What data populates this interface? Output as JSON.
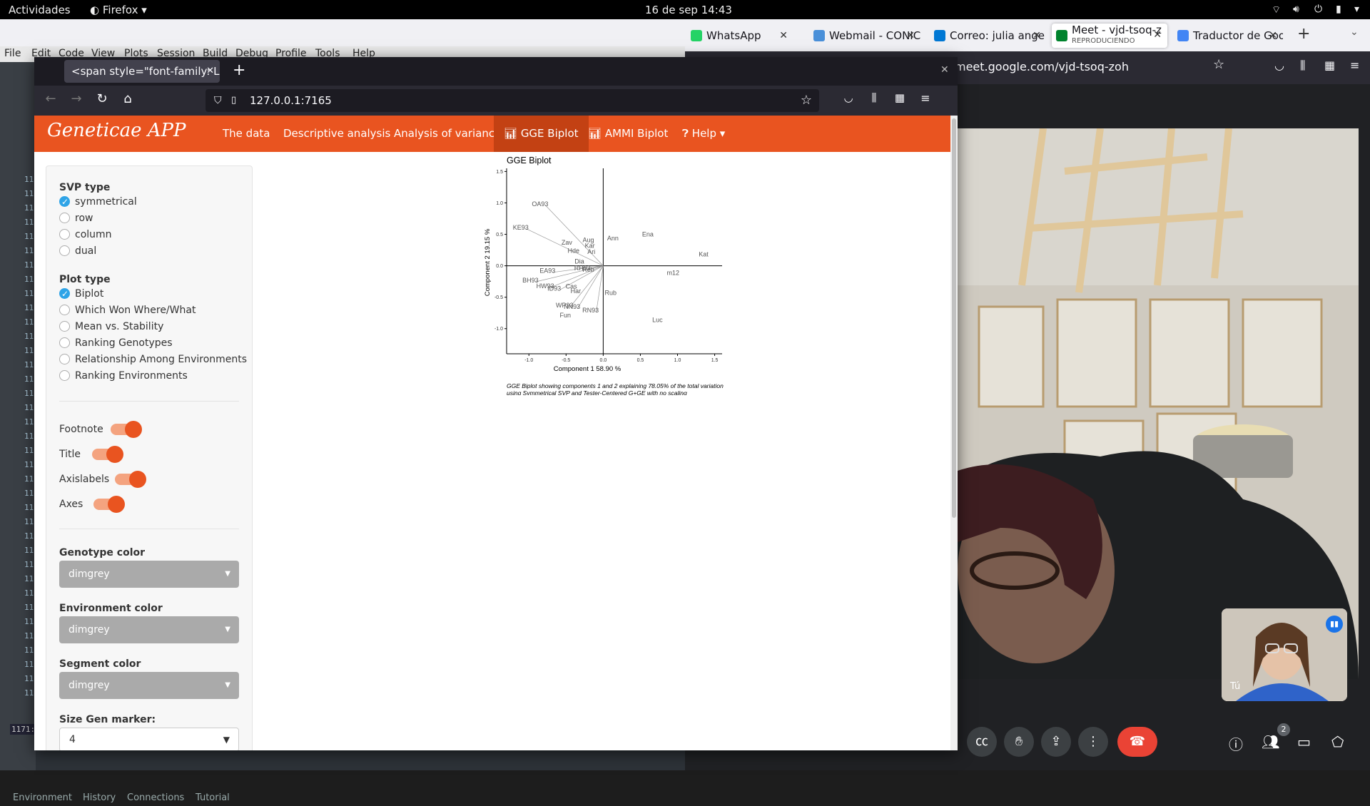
{
  "topbar": {
    "activities": "Actividades",
    "app": "Firefox",
    "datetime": "16 de sep  14:43"
  },
  "bg_browser": {
    "tabs": [
      {
        "label": "WhatsApp",
        "icon_color": "#25d366"
      },
      {
        "label": "Webmail - CONIC",
        "icon_color": "#4a90d9"
      },
      {
        "label": "Correo: julia ange",
        "icon_color": "#0078d4"
      },
      {
        "label": "Meet - vjd-tsoq-z",
        "sublabel": "REPRODUCIENDO",
        "icon_color": "#00832d"
      },
      {
        "label": "Traductor de Goo",
        "icon_color": "#4285f4"
      }
    ],
    "url": "meet.google.com/vjd-tsoq-zoh",
    "self_view_label": "Tú",
    "participants_count": "2"
  },
  "rstudio": {
    "menu": [
      "File",
      "Edit",
      "Code",
      "View",
      "Plots",
      "Session",
      "Build",
      "Debug",
      "Profile",
      "Tools",
      "Help"
    ],
    "line_prefix": "11",
    "line_count_label": "1171:",
    "bottom_tabs": [
      "Environment",
      "History",
      "Connections",
      "Tutorial"
    ]
  },
  "fg_browser": {
    "tab_title": "<span style=\"font-family: Lot",
    "url": "127.0.0.1:7165"
  },
  "app": {
    "brand": "Geneticae APP",
    "nav": [
      {
        "label": "The data"
      },
      {
        "label": "Descriptive analysis"
      },
      {
        "label": "Analysis of variance"
      },
      {
        "label": "GGE Biplot",
        "icon": "bar-chart-icon",
        "active": true
      },
      {
        "label": "AMMI Biplot",
        "icon": "bar-chart-icon"
      },
      {
        "label": "Help",
        "icon": "question-circle-icon"
      }
    ]
  },
  "sidebar": {
    "svp_label": "SVP type",
    "svp_options": [
      {
        "label": "symmetrical",
        "selected": true
      },
      {
        "label": "row",
        "selected": false
      },
      {
        "label": "column",
        "selected": false
      },
      {
        "label": "dual",
        "selected": false
      }
    ],
    "plot_label": "Plot type",
    "plot_options": [
      {
        "label": "Biplot",
        "selected": true
      },
      {
        "label": "Which Won Where/What",
        "selected": false
      },
      {
        "label": "Mean vs. Stability",
        "selected": false
      },
      {
        "label": "Ranking Genotypes",
        "selected": false
      },
      {
        "label": "Relationship Among Environments",
        "selected": false
      },
      {
        "label": "Ranking Environments",
        "selected": false
      }
    ],
    "switches": [
      {
        "label": "Footnote",
        "on": true
      },
      {
        "label": "Title",
        "on": true
      },
      {
        "label": "Axislabels",
        "on": true
      },
      {
        "label": "Axes",
        "on": true
      }
    ],
    "genotype_color_label": "Genotype color",
    "genotype_color": "dimgrey",
    "environment_color_label": "Environment color",
    "environment_color": "dimgrey",
    "segment_color_label": "Segment color",
    "segment_color": "dimgrey",
    "size_gen_label": "Size Gen marker:",
    "size_gen": "4"
  },
  "chart_data": {
    "type": "scatter",
    "title": "GGE Biplot",
    "xlabel": "Component 1 58.90 %",
    "ylabel": "Component 2 19.15 %",
    "xlim": [
      -1.3,
      1.6
    ],
    "ylim": [
      -1.4,
      1.55
    ],
    "xticks": [
      "-1.0",
      "-0.5",
      "0.0",
      "0.5",
      "1.0",
      "1.5"
    ],
    "yticks": [
      "1.5",
      "1.0",
      "0.5",
      "0.0",
      "-0.5",
      "-1.0"
    ],
    "footnote": [
      "GGE Biplot showing components 1 and 2 explaining 78.05% of the total variation",
      "using Symmetrical SVP and Tester-Centered G+GE with no scaling"
    ],
    "genotypes": [
      {
        "label": "Ann",
        "x": 0.13,
        "y": 0.44
      },
      {
        "label": "Ena",
        "x": 0.6,
        "y": 0.5
      },
      {
        "label": "Kat",
        "x": 1.35,
        "y": 0.18
      },
      {
        "label": "m12",
        "x": 0.94,
        "y": -0.11
      },
      {
        "label": "Rub",
        "x": 0.1,
        "y": -0.43
      },
      {
        "label": "Luc",
        "x": 0.73,
        "y": -0.86
      },
      {
        "label": "Aug",
        "x": -0.2,
        "y": 0.41
      },
      {
        "label": "Kar",
        "x": -0.18,
        "y": 0.32
      },
      {
        "label": "Ari",
        "x": -0.16,
        "y": 0.22
      },
      {
        "label": "Zav",
        "x": -0.49,
        "y": 0.37
      },
      {
        "label": "Hde",
        "x": -0.4,
        "y": 0.24
      },
      {
        "label": "Dia",
        "x": -0.32,
        "y": 0.07
      },
      {
        "label": "Reb",
        "x": -0.2,
        "y": -0.06
      },
      {
        "label": "Cas",
        "x": -0.43,
        "y": -0.33
      },
      {
        "label": "Har",
        "x": -0.37,
        "y": -0.4
      },
      {
        "label": "Fun",
        "x": -0.51,
        "y": -0.79
      }
    ],
    "environments": [
      {
        "label": "OA93",
        "x": -0.85,
        "y": 0.98
      },
      {
        "label": "KE93",
        "x": -1.11,
        "y": 0.61
      },
      {
        "label": "EA93",
        "x": -0.75,
        "y": -0.08
      },
      {
        "label": "BH93",
        "x": -0.98,
        "y": -0.23
      },
      {
        "label": "HW93",
        "x": -0.78,
        "y": -0.32
      },
      {
        "label": "ID93",
        "x": -0.66,
        "y": -0.36
      },
      {
        "label": "WP93",
        "x": -0.52,
        "y": -0.63
      },
      {
        "label": "NN93",
        "x": -0.42,
        "y": -0.65
      },
      {
        "label": "RN93",
        "x": -0.17,
        "y": -0.71
      },
      {
        "label": "RH93",
        "x": -0.28,
        "y": -0.04
      }
    ]
  }
}
